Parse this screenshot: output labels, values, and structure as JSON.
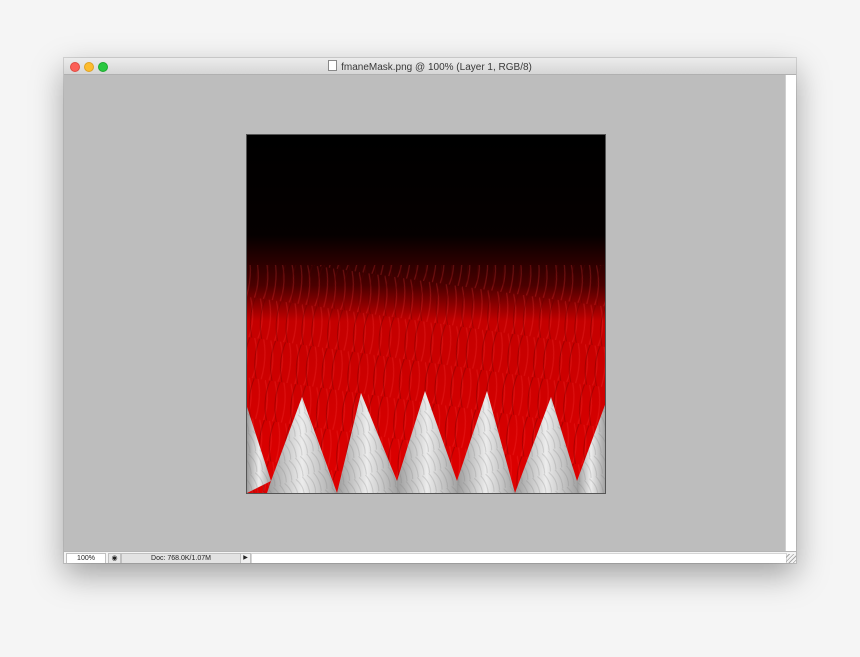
{
  "window": {
    "title": "fmaneMask.png @ 100% (Layer 1, RGB/8)"
  },
  "statusbar": {
    "zoom": "100%",
    "doc_info": "Doc: 768.0K/1.07M",
    "arrow": "▶",
    "icon_glyph": "◉"
  },
  "artwork": {
    "colors": {
      "top": "#000000",
      "fur": "#d90000",
      "teeth": "#d6d6d6"
    }
  }
}
